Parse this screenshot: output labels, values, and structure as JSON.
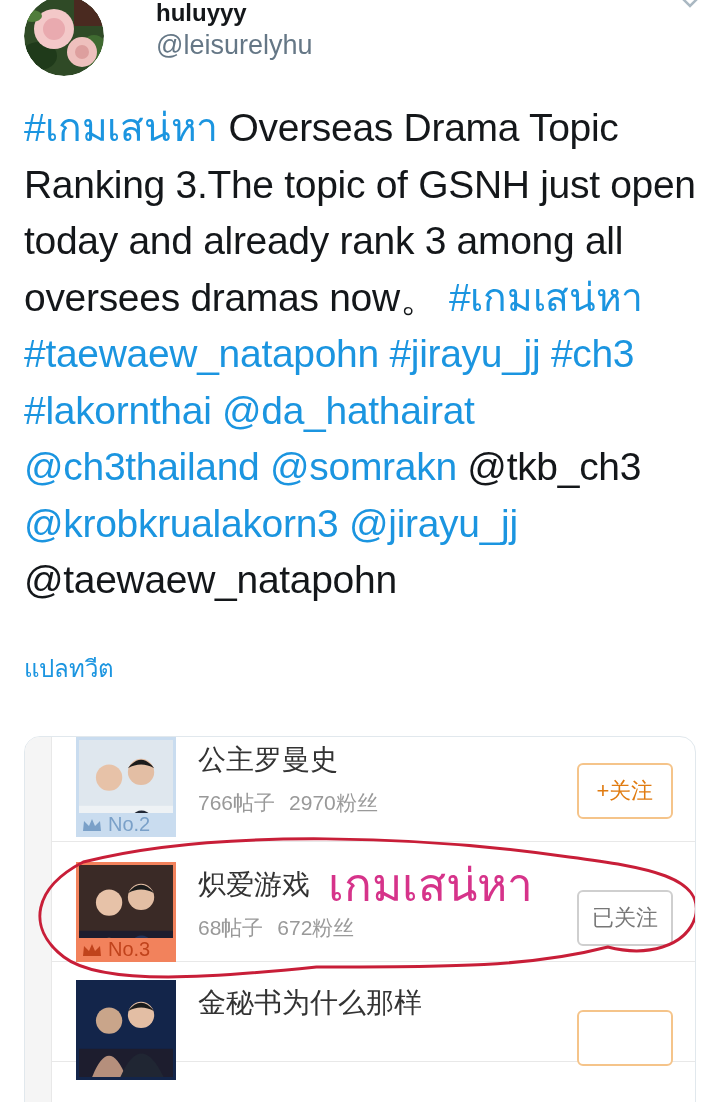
{
  "author": {
    "name": "huluyyy",
    "handle": "@leisurelyhu"
  },
  "tweet": {
    "segments": [
      {
        "kind": "link",
        "text": "#เกมเสน่หา"
      },
      {
        "kind": "text",
        "text": "Overseas Drama Topic Ranking 3.The topic of GSNH just open today and already rank 3 among all oversees dramas now。"
      },
      {
        "kind": "link",
        "text": "#เกมเสน่หา"
      },
      {
        "kind": "link",
        "text": "#taewaew_natapohn"
      },
      {
        "kind": "link",
        "text": "#jirayu_jj"
      },
      {
        "kind": "link",
        "text": "#ch3"
      },
      {
        "kind": "link",
        "text": "#lakornthai"
      },
      {
        "kind": "link",
        "text": "@da_hathairat"
      },
      {
        "kind": "link",
        "text": "@ch3thailand"
      },
      {
        "kind": "link",
        "text": "@somrakn"
      },
      {
        "kind": "text",
        "text": "@tkb_ch3"
      },
      {
        "kind": "link",
        "text": "@krobkrualakorn3"
      },
      {
        "kind": "link",
        "text": "@jirayu_jj"
      },
      {
        "kind": "text",
        "text": "@taewaew_natapohn"
      }
    ]
  },
  "translate_link": "แปลทวีต",
  "embedded_image": {
    "rows": [
      {
        "rank": "No.2",
        "color": "#c9dcef",
        "title": "公主罗曼史",
        "posts": "766帖子",
        "fans": "2970粉丝",
        "button": "+关注",
        "followed": false
      },
      {
        "rank": "No.3",
        "color": "#f2825c",
        "title": "炽爱游戏",
        "overlay_text": "เกมเสน่หา",
        "posts": "68帖子",
        "fans": "672粉丝",
        "button": "已关注",
        "followed": true
      },
      {
        "title": "金秘书为什么那样",
        "followed": false
      }
    ]
  }
}
